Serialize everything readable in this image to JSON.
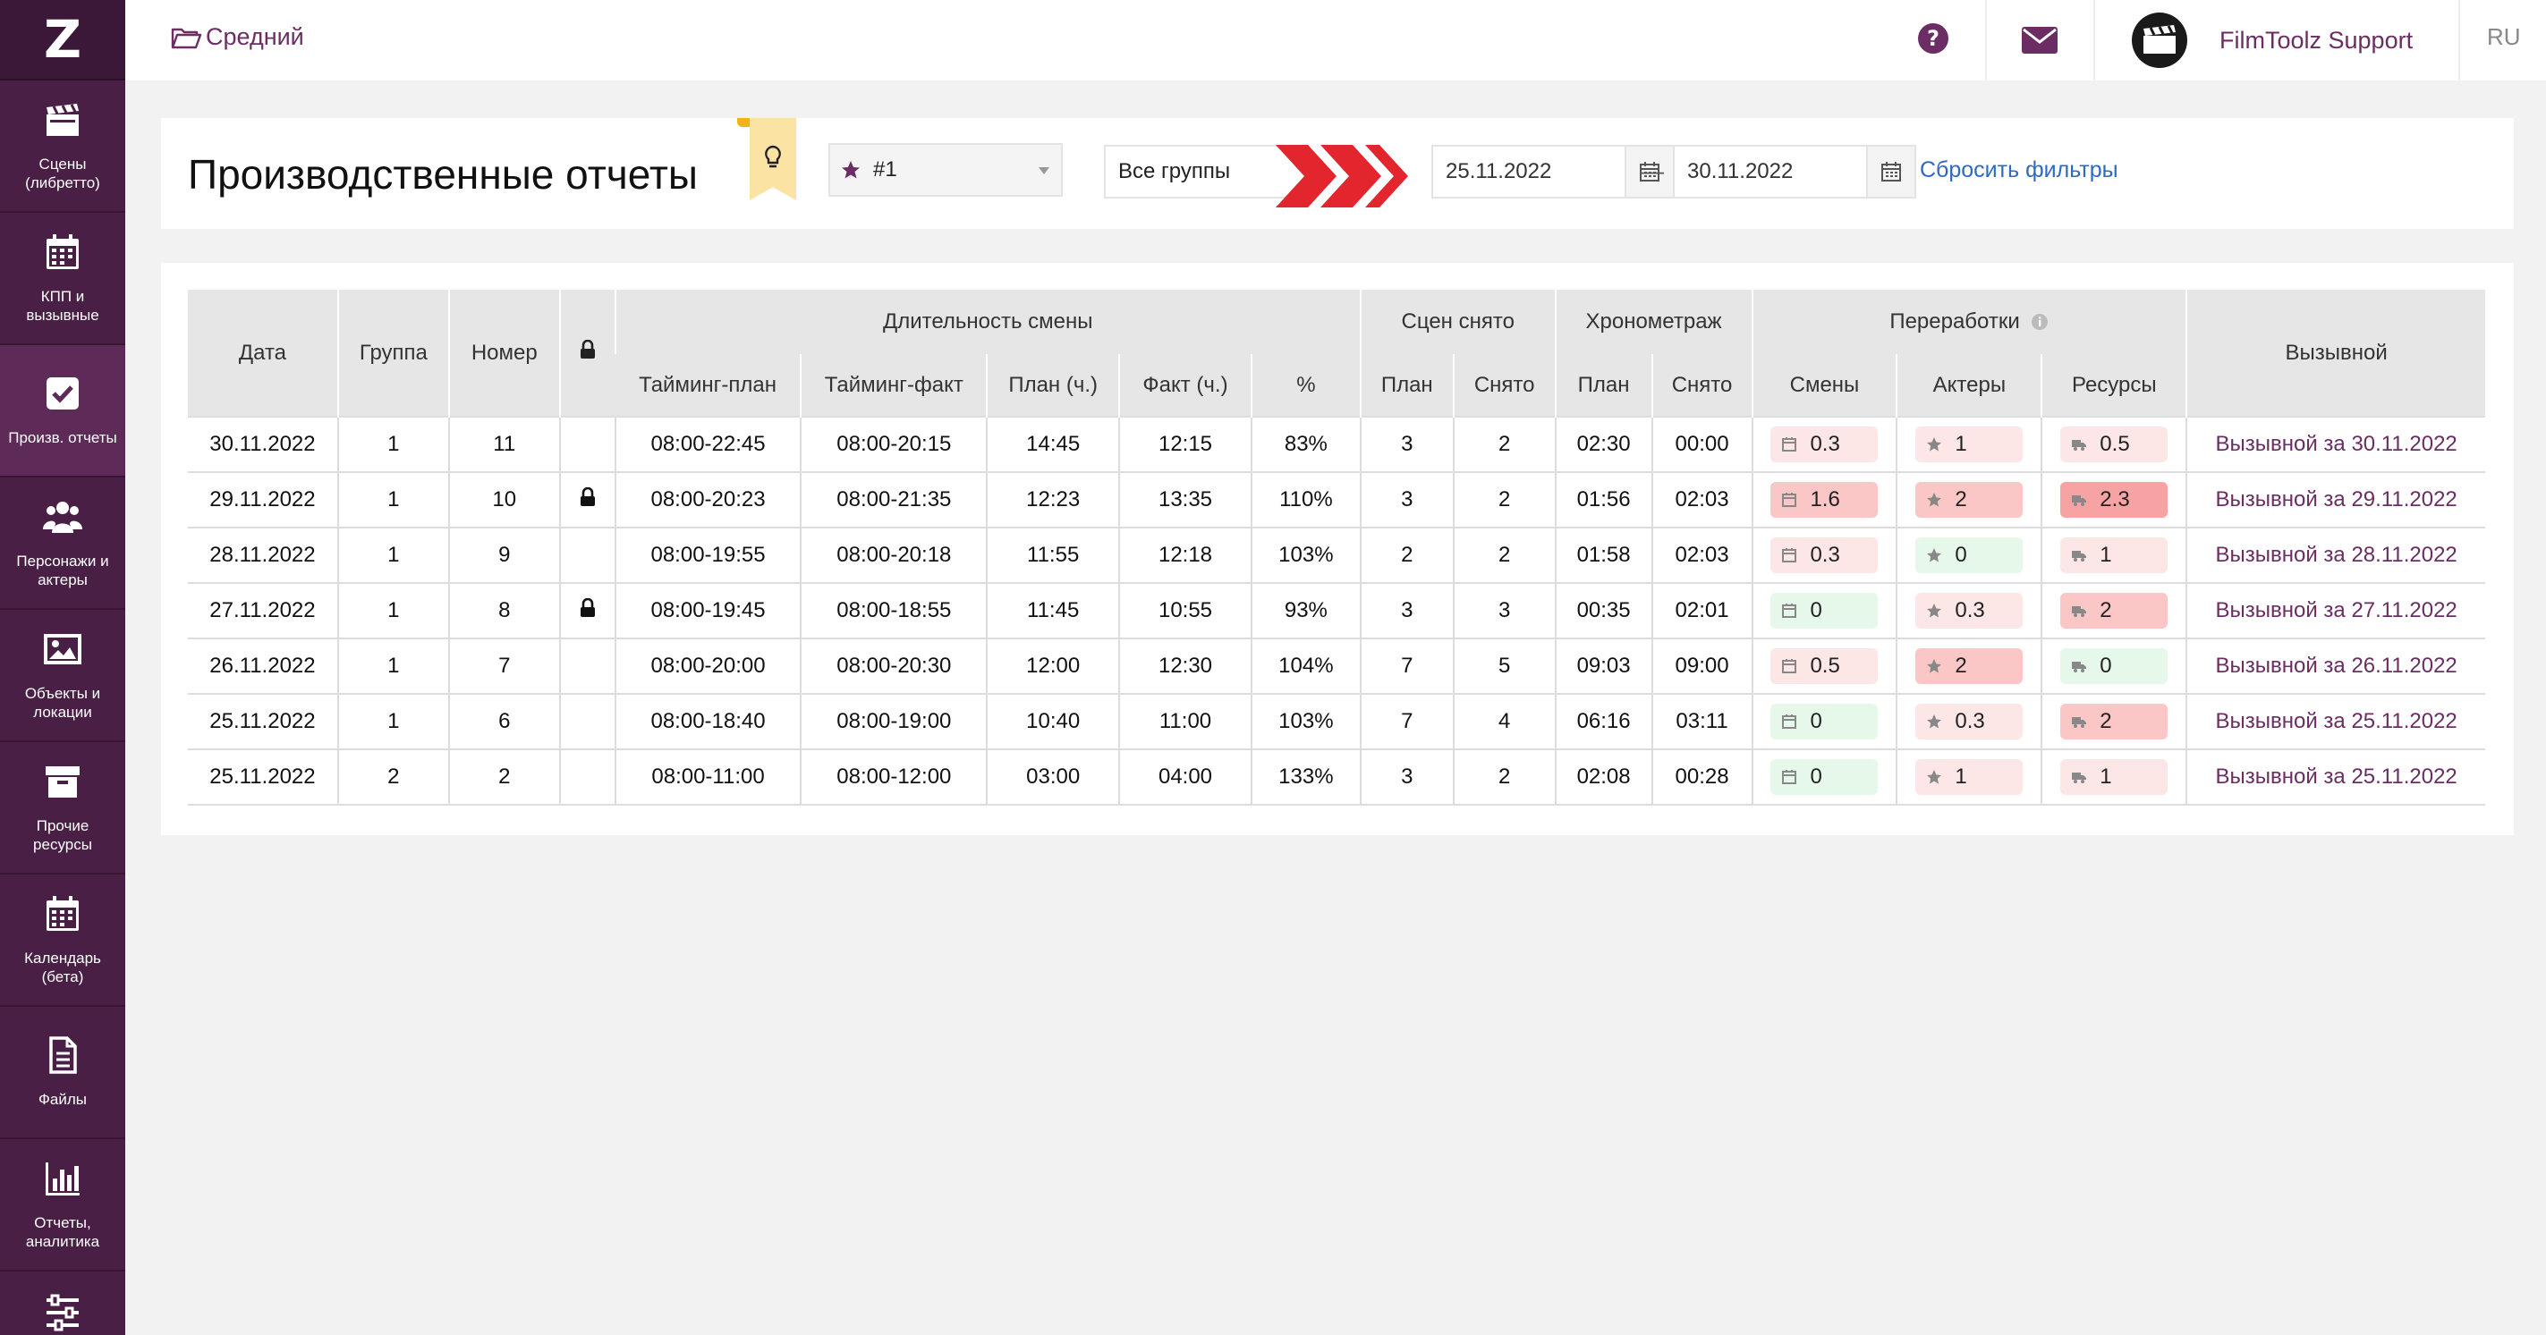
{
  "app": {
    "logo": "Z"
  },
  "sidebar": {
    "items": [
      {
        "label": "Сцены\n(либретто)",
        "icon": "clapperboard-icon"
      },
      {
        "label": "КПП и\nвызывные",
        "icon": "calendar-icon"
      },
      {
        "label": "Произв. отчеты",
        "icon": "checkbox-icon",
        "active": true
      },
      {
        "label": "Персонажи и\nактеры",
        "icon": "people-icon"
      },
      {
        "label": "Объекты и\nлокации",
        "icon": "image-icon"
      },
      {
        "label": "Прочие\nресурсы",
        "icon": "archive-icon"
      },
      {
        "label": "Календарь\n(бета)",
        "icon": "calendar-grid-icon"
      },
      {
        "label": "Файлы",
        "icon": "file-icon"
      },
      {
        "label": "Отчеты,\nаналитика",
        "icon": "bar-chart-icon"
      },
      {
        "label": "",
        "icon": "sliders-icon"
      }
    ]
  },
  "topbar": {
    "project": "Средний",
    "user": "FilmToolz Support",
    "lang": "RU"
  },
  "filters": {
    "title": "Производственные отчеты",
    "unit": "#1",
    "group": "Все группы",
    "date_from": "25.11.2022",
    "date_to": "30.11.2022",
    "dash": "—",
    "reset": "Сбросить фильтры"
  },
  "table": {
    "head1": {
      "date": "Дата",
      "group": "Группа",
      "number": "Номер",
      "duration": "Длительность смены",
      "scenes": "Сцен снято",
      "chrono": "Хронометраж",
      "overtime": "Переработки",
      "callsheet": "Вызывной"
    },
    "head2": {
      "timing_plan": "Тайминг-план",
      "timing_fact": "Тайминг-факт",
      "plan_h": "План (ч.)",
      "fact_h": "Факт (ч.)",
      "pct": "%",
      "sc_plan": "План",
      "sc_done": "Снято",
      "ch_plan": "План",
      "ch_done": "Снято",
      "ot_shifts": "Смены",
      "ot_actors": "Актеры",
      "ot_res": "Ресурсы"
    },
    "rows": [
      {
        "date": "30.11.2022",
        "group": "1",
        "number": "11",
        "locked": false,
        "tplan": "08:00-22:45",
        "tfact": "08:00-20:15",
        "plan_h": "14:45",
        "fact_h": "12:15",
        "pct": "83%",
        "sc_plan": "3",
        "sc_done": "2",
        "ch_plan": "02:30",
        "ch_done": "00:00",
        "ot_shifts": "0.3",
        "ot_shifts_lvl": "r1",
        "ot_actors": "1",
        "ot_actors_lvl": "r1",
        "ot_res": "0.5",
        "ot_res_lvl": "r1",
        "call": "Вызывной за 30.11.2022"
      },
      {
        "date": "29.11.2022",
        "group": "1",
        "number": "10",
        "locked": true,
        "tplan": "08:00-20:23",
        "tfact": "08:00-21:35",
        "plan_h": "12:23",
        "fact_h": "13:35",
        "pct": "110%",
        "sc_plan": "3",
        "sc_done": "2",
        "ch_plan": "01:56",
        "ch_done": "02:03",
        "ot_shifts": "1.6",
        "ot_shifts_lvl": "r2",
        "ot_actors": "2",
        "ot_actors_lvl": "r2",
        "ot_res": "2.3",
        "ot_res_lvl": "r3",
        "call": "Вызывной за 29.11.2022"
      },
      {
        "date": "28.11.2022",
        "group": "1",
        "number": "9",
        "locked": false,
        "tplan": "08:00-19:55",
        "tfact": "08:00-20:18",
        "plan_h": "11:55",
        "fact_h": "12:18",
        "pct": "103%",
        "sc_plan": "2",
        "sc_done": "2",
        "ch_plan": "01:58",
        "ch_done": "02:03",
        "ot_shifts": "0.3",
        "ot_shifts_lvl": "r1",
        "ot_actors": "0",
        "ot_actors_lvl": "g",
        "ot_res": "1",
        "ot_res_lvl": "r1",
        "call": "Вызывной за 28.11.2022"
      },
      {
        "date": "27.11.2022",
        "group": "1",
        "number": "8",
        "locked": true,
        "tplan": "08:00-19:45",
        "tfact": "08:00-18:55",
        "plan_h": "11:45",
        "fact_h": "10:55",
        "pct": "93%",
        "sc_plan": "3",
        "sc_done": "3",
        "ch_plan": "00:35",
        "ch_done": "02:01",
        "ot_shifts": "0",
        "ot_shifts_lvl": "g",
        "ot_actors": "0.3",
        "ot_actors_lvl": "r1",
        "ot_res": "2",
        "ot_res_lvl": "r2",
        "call": "Вызывной за 27.11.2022"
      },
      {
        "date": "26.11.2022",
        "group": "1",
        "number": "7",
        "locked": false,
        "tplan": "08:00-20:00",
        "tfact": "08:00-20:30",
        "plan_h": "12:00",
        "fact_h": "12:30",
        "pct": "104%",
        "sc_plan": "7",
        "sc_done": "5",
        "ch_plan": "09:03",
        "ch_done": "09:00",
        "ot_shifts": "0.5",
        "ot_shifts_lvl": "r1",
        "ot_actors": "2",
        "ot_actors_lvl": "r2",
        "ot_res": "0",
        "ot_res_lvl": "g",
        "call": "Вызывной за 26.11.2022"
      },
      {
        "date": "25.11.2022",
        "group": "1",
        "number": "6",
        "locked": false,
        "tplan": "08:00-18:40",
        "tfact": "08:00-19:00",
        "plan_h": "10:40",
        "fact_h": "11:00",
        "pct": "103%",
        "sc_plan": "7",
        "sc_done": "4",
        "ch_plan": "06:16",
        "ch_done": "03:11",
        "ot_shifts": "0",
        "ot_shifts_lvl": "g",
        "ot_actors": "0.3",
        "ot_actors_lvl": "r1",
        "ot_res": "2",
        "ot_res_lvl": "r2",
        "call": "Вызывной за 25.11.2022"
      },
      {
        "date": "25.11.2022",
        "group": "2",
        "number": "2",
        "locked": false,
        "tplan": "08:00-11:00",
        "tfact": "08:00-12:00",
        "plan_h": "03:00",
        "fact_h": "04:00",
        "pct": "133%",
        "sc_plan": "3",
        "sc_done": "2",
        "ch_plan": "02:08",
        "ch_done": "00:28",
        "ot_shifts": "0",
        "ot_shifts_lvl": "g",
        "ot_actors": "1",
        "ot_actors_lvl": "r1",
        "ot_res": "1",
        "ot_res_lvl": "r1",
        "call": "Вызывной за 25.11.2022"
      }
    ]
  },
  "colors": {
    "sidebar": "#4a1f45",
    "accent": "#6b2d63",
    "link": "#2e69c4",
    "chevron": "#e3262e"
  }
}
